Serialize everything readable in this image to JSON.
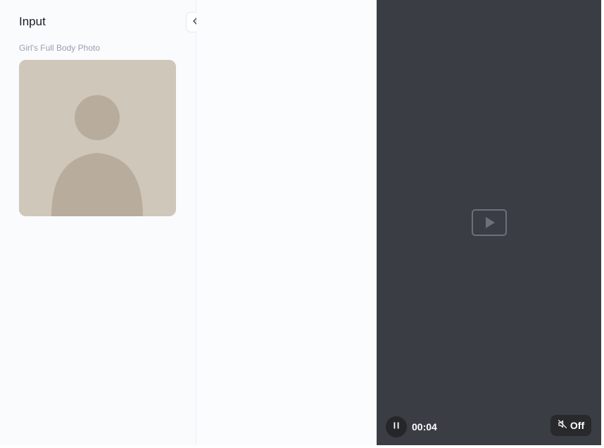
{
  "input_panel": {
    "title": "Input",
    "photo_label": "Girl's Full Body Photo",
    "collapse_icon": "chevrons-left-icon"
  },
  "video": {
    "time": "00:04",
    "play_state_icon": "pause-icon",
    "sound_icon": "speaker-muted-icon",
    "sound_label": "Off"
  }
}
